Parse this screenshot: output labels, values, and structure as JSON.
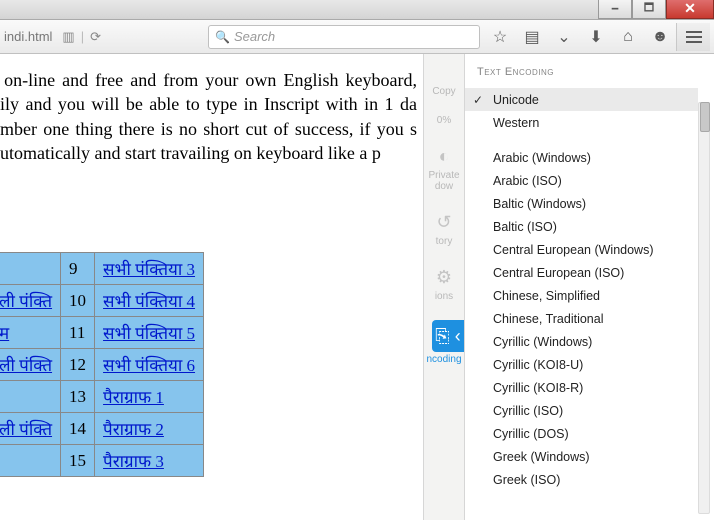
{
  "url_fragment": "indi.html",
  "search": {
    "placeholder": "Search"
  },
  "zoom_label": "0%",
  "body_paragraph": "; on-line and free and from your own English keyboard, aily and you will be able to type in Inscript with in 1 da ember one thing there is no short cut of success, if you s automatically and start travailing on keyboard like a p",
  "table": {
    "rows": [
      {
        "c1": "",
        "c2": "9",
        "c3": "सभी पंक्तिया 3"
      },
      {
        "c1": "ली पंक्ति",
        "c2": "10",
        "c3": "सभी पंक्तिया 4"
      },
      {
        "c1": "म",
        "c2": "11",
        "c3": "सभी पंक्तिया 5"
      },
      {
        "c1": "ली पंक्ति",
        "c2": "12",
        "c3": "सभी पंक्तिया 6"
      },
      {
        "c1": "",
        "c2": "13",
        "c3": "पैराग्राफ 1"
      },
      {
        "c1": "ली पंक्ति",
        "c2": "14",
        "c3": "पैराग्राफ 2"
      },
      {
        "c1": "",
        "c2": "15",
        "c3": "पैराग्राफ 3"
      }
    ]
  },
  "side_strip": {
    "copy": "Copy",
    "private": "Private\ndow",
    "history": "tory",
    "options": "ions",
    "encoding": "ncoding"
  },
  "encoding_panel": {
    "title": "Text Encoding",
    "items": [
      {
        "label": "Unicode",
        "selected": true
      },
      {
        "label": "Western",
        "selected": false
      }
    ],
    "more": [
      "Arabic (Windows)",
      "Arabic (ISO)",
      "Baltic (Windows)",
      "Baltic (ISO)",
      "Central European (Windows)",
      "Central European (ISO)",
      "Chinese, Simplified",
      "Chinese, Traditional",
      "Cyrillic (Windows)",
      "Cyrillic (KOI8-U)",
      "Cyrillic (KOI8-R)",
      "Cyrillic (ISO)",
      "Cyrillic (DOS)",
      "Greek (Windows)",
      "Greek (ISO)"
    ]
  }
}
